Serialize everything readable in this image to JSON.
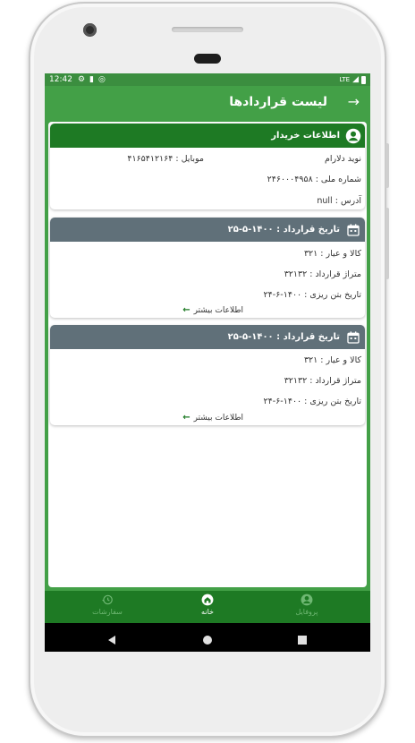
{
  "status_bar": {
    "time": "12:42",
    "network": "LTE"
  },
  "app_bar": {
    "title": "لیست قراردادها"
  },
  "buyer_card": {
    "header": "اطلاعات خریدار",
    "name": "نوید دلارام",
    "mobile": "موبایل : ۴۱۶۵۴۱۲۱۶۴",
    "national_id": "شماره ملی : ۲۴۶۰۰۰۴۹۵۸",
    "address": "آدرس : null"
  },
  "contracts": [
    {
      "header": "تاریخ قرارداد : ۱۴۰۰-۵-۲۵",
      "product": "کالا و عیار : ۳۲۱",
      "tonnage": "متراژ قرارداد : ۳۲۱۳۲",
      "pour_date": "تاریخ بتن ریزی : ۱۴۰۰-۶-۲۴",
      "more": "اطلاعات بیشتر"
    },
    {
      "header": "تاریخ قرارداد : ۱۴۰۰-۵-۲۵",
      "product": "کالا و عیار : ۳۲۱",
      "tonnage": "متراژ قرارداد : ۳۲۱۳۲",
      "pour_date": "تاریخ بتن ریزی : ۱۴۰۰-۶-۲۴",
      "more": "اطلاعات بیشتر"
    }
  ],
  "bottom_nav": {
    "orders": "سفارشات",
    "home": "خانه",
    "profile": "پروفایل"
  },
  "colors": {
    "primary": "#43a047",
    "primary_dark": "#1e7a24",
    "card_header_grey": "#607079"
  }
}
